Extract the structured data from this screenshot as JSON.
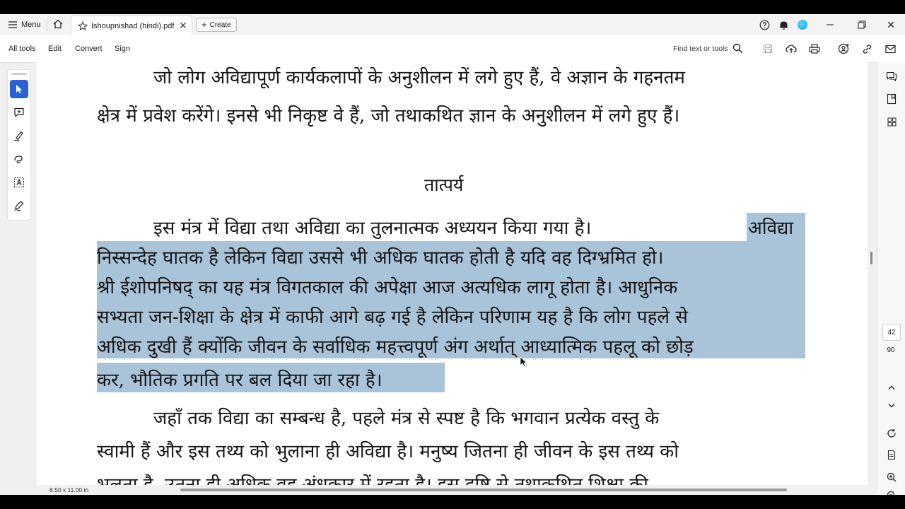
{
  "titlebar": {
    "menu_label": "Menu",
    "tab_title": "Ishoupnishad (hindi).pdf",
    "tab_close": "✕",
    "create_label": "Create",
    "create_plus": "+",
    "window_close": "✕"
  },
  "toolbar": {
    "all_tools": "All tools",
    "edit": "Edit",
    "convert": "Convert",
    "sign": "Sign",
    "find_label": "Find text or tools"
  },
  "document": {
    "para1_line1": "जो लोग अविद्यापूर्ण कार्यकलापों के अनुशीलन में लगे हुए हैं, वे अज्ञान के गहनतम",
    "para1_line2": "क्षेत्र में प्रवेश करेंगे। इनसे भी निकृष्ट वे हैं, जो तथाकथित ज्ञान के अनुशीलन में लगे हुए हैं।",
    "heading": "तात्पर्य",
    "para2_line1_plain": "इस मंत्र में विद्या तथा अविद्या का तुलनात्मक अध्ययन किया गया है।",
    "para2_line1_hl": "अविद्या",
    "para2_line2": "निस्सन्देह घातक है लेकिन विद्या उससे भी अधिक घातक होती है यदि वह दिग्भ्रमित हो।",
    "para2_line3": "श्री ईशोपनिषद् का यह मंत्र विगतकाल की अपेक्षा आज अत्यधिक लागू होता है। आधुनिक",
    "para2_line4": "सभ्यता जन-शिक्षा के क्षेत्र में काफी आगे बढ़ गई है लेकिन परिणाम यह है कि लोग पहले से",
    "para2_line5": "अधिक दुखी हैं क्योंकि जीवन के सर्वाधिक महत्त्वपूर्ण अंग अर्थात् आध्यात्मिक पहलू को छोड़",
    "para2_line6": "कर, भौतिक प्रगति पर बल दिया जा रहा है।",
    "para3_line1": "जहाँ तक विद्या का सम्बन्ध है, पहले मंत्र से स्पष्ट है कि भगवान प्रत्येक वस्तु के",
    "para3_line2": "स्वामी हैं और इस तथ्य को भुलाना ही अविद्या है। मनुष्य जितना ही जीवन के इस तथ्य को",
    "para3_line3": "भूलता है, उतना ही अधिक वह अंधकार में रहता है। इस दृष्टि से तथाकथित शिक्षा की",
    "highlight_color": "#a9c3d9"
  },
  "status": {
    "page_size": "8.50 x 11.00 in",
    "current_page": "42",
    "total_pages": "90"
  },
  "colors": {
    "accent": "#2a62d6",
    "avatar": "#1b9be0"
  }
}
